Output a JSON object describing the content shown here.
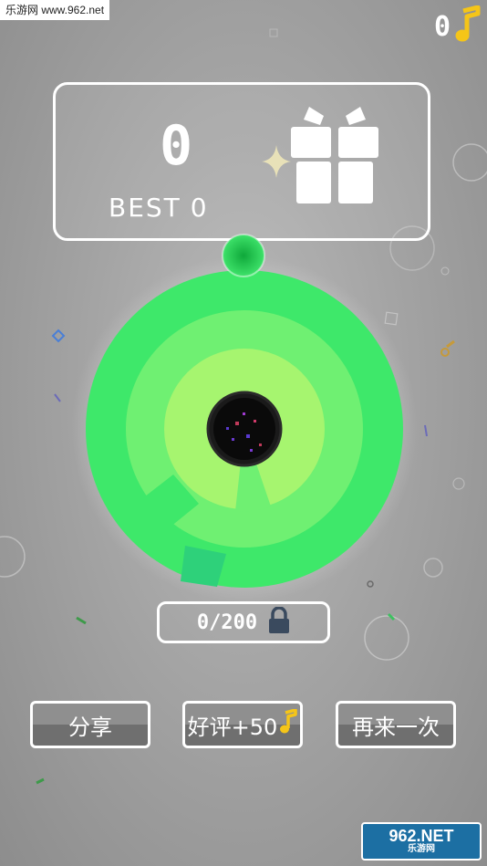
{
  "watermark_top": "乐游网 www.962.net",
  "coins": {
    "count": "0",
    "icon": "music-note-icon",
    "icon_color": "#f5c518"
  },
  "score_panel": {
    "score": "0",
    "best_label": "BEST",
    "best_value": "0",
    "gift_icon": "gift-icon"
  },
  "wheel": {
    "colors": {
      "outer": "#3ee86a",
      "middle": "#6ff072",
      "inner": "#a6f56f",
      "gap": "#2ed17a",
      "ball": "#3ed862",
      "hole": "#111111"
    }
  },
  "progress": {
    "text": "0/200",
    "current": 0,
    "total": 200,
    "lock_icon": "lock-icon"
  },
  "buttons": {
    "share": "分享",
    "review": "好评+50",
    "again": "再来一次"
  },
  "watermark_bottom": {
    "big": "962.NET",
    "small": "乐游网"
  }
}
